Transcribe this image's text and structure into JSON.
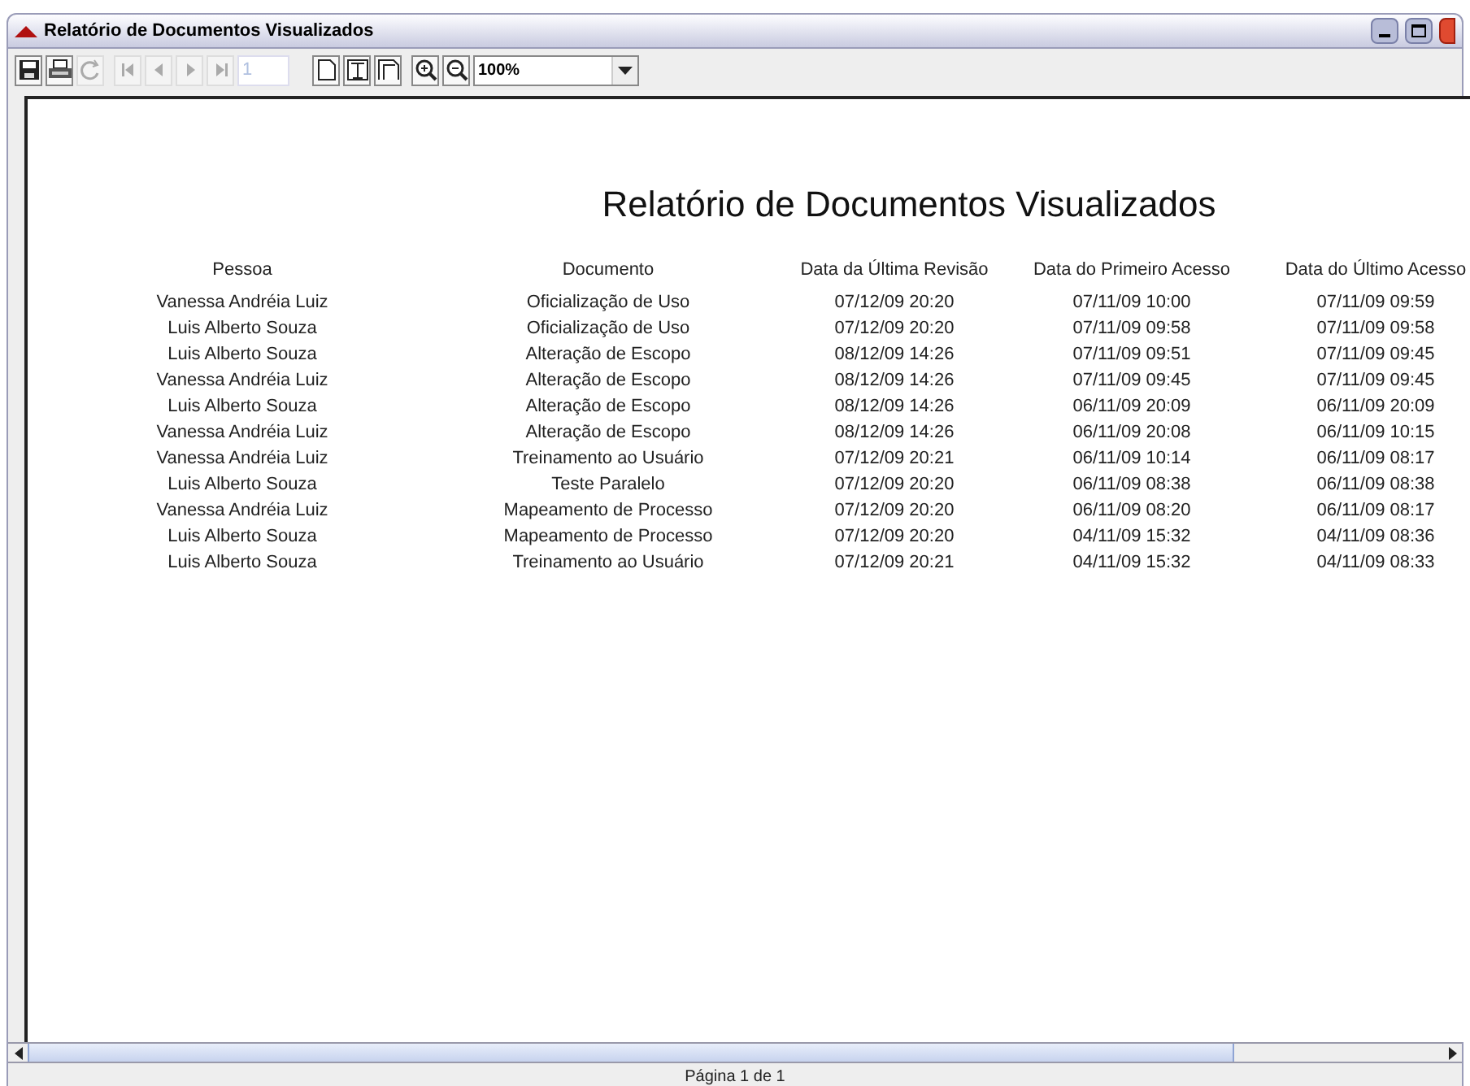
{
  "window": {
    "title": "Relatório de Documentos Visualizados"
  },
  "toolbar": {
    "groups": [
      [
        {
          "kind": "save",
          "disabled": false
        },
        {
          "kind": "print",
          "disabled": false
        },
        {
          "kind": "refresh",
          "disabled": true
        }
      ],
      [
        {
          "kind": "first",
          "disabled": true
        },
        {
          "kind": "prev",
          "disabled": true
        },
        {
          "kind": "next",
          "disabled": true
        },
        {
          "kind": "last",
          "disabled": true
        }
      ],
      [
        {
          "kind": "single",
          "disabled": false
        },
        {
          "kind": "width",
          "disabled": false
        },
        {
          "kind": "whole",
          "disabled": false
        }
      ],
      [
        {
          "kind": "zoomin",
          "disabled": false
        },
        {
          "kind": "zoomout",
          "disabled": false
        }
      ]
    ],
    "page_field": {
      "value": "1",
      "disabled": true
    },
    "zoom": {
      "value": "100%"
    }
  },
  "report": {
    "title": "Relatório de Documentos Visualizados",
    "columns": [
      "Pessoa",
      "Documento",
      "Data da Última Revisão",
      "Data do Primeiro Acesso",
      "Data do Último Acesso"
    ],
    "rows": [
      [
        "Vanessa Andréia Luiz",
        "Oficialização de Uso",
        "07/12/09 20:20",
        "07/11/09 10:00",
        "07/11/09 09:59"
      ],
      [
        "Luis Alberto Souza",
        "Oficialização de Uso",
        "07/12/09 20:20",
        "07/11/09 09:58",
        "07/11/09 09:58"
      ],
      [
        "Luis Alberto Souza",
        "Alteração de Escopo",
        "08/12/09 14:26",
        "07/11/09 09:51",
        "07/11/09 09:45"
      ],
      [
        "Vanessa Andréia Luiz",
        "Alteração de Escopo",
        "08/12/09 14:26",
        "07/11/09 09:45",
        "07/11/09 09:45"
      ],
      [
        "Luis Alberto Souza",
        "Alteração de Escopo",
        "08/12/09 14:26",
        "06/11/09 20:09",
        "06/11/09 20:09"
      ],
      [
        "Vanessa Andréia Luiz",
        "Alteração de Escopo",
        "08/12/09 14:26",
        "06/11/09 20:08",
        "06/11/09 10:15"
      ],
      [
        "Vanessa Andréia Luiz",
        "Treinamento ao Usuário",
        "07/12/09 20:21",
        "06/11/09 10:14",
        "06/11/09 08:17"
      ],
      [
        "Luis Alberto Souza",
        "Teste Paralelo",
        "07/12/09 20:20",
        "06/11/09 08:38",
        "06/11/09 08:38"
      ],
      [
        "Vanessa Andréia Luiz",
        "Mapeamento de Processo",
        "07/12/09 20:20",
        "06/11/09 08:20",
        "06/11/09 08:17"
      ],
      [
        "Luis Alberto Souza",
        "Mapeamento de Processo",
        "07/12/09 20:20",
        "04/11/09 15:32",
        "04/11/09 08:36"
      ],
      [
        "Luis Alberto Souza",
        "Treinamento ao Usuário",
        "07/12/09 20:21",
        "04/11/09 15:32",
        "04/11/09 08:33"
      ]
    ]
  },
  "status_bar": {
    "text": "Página 1 de 1"
  }
}
